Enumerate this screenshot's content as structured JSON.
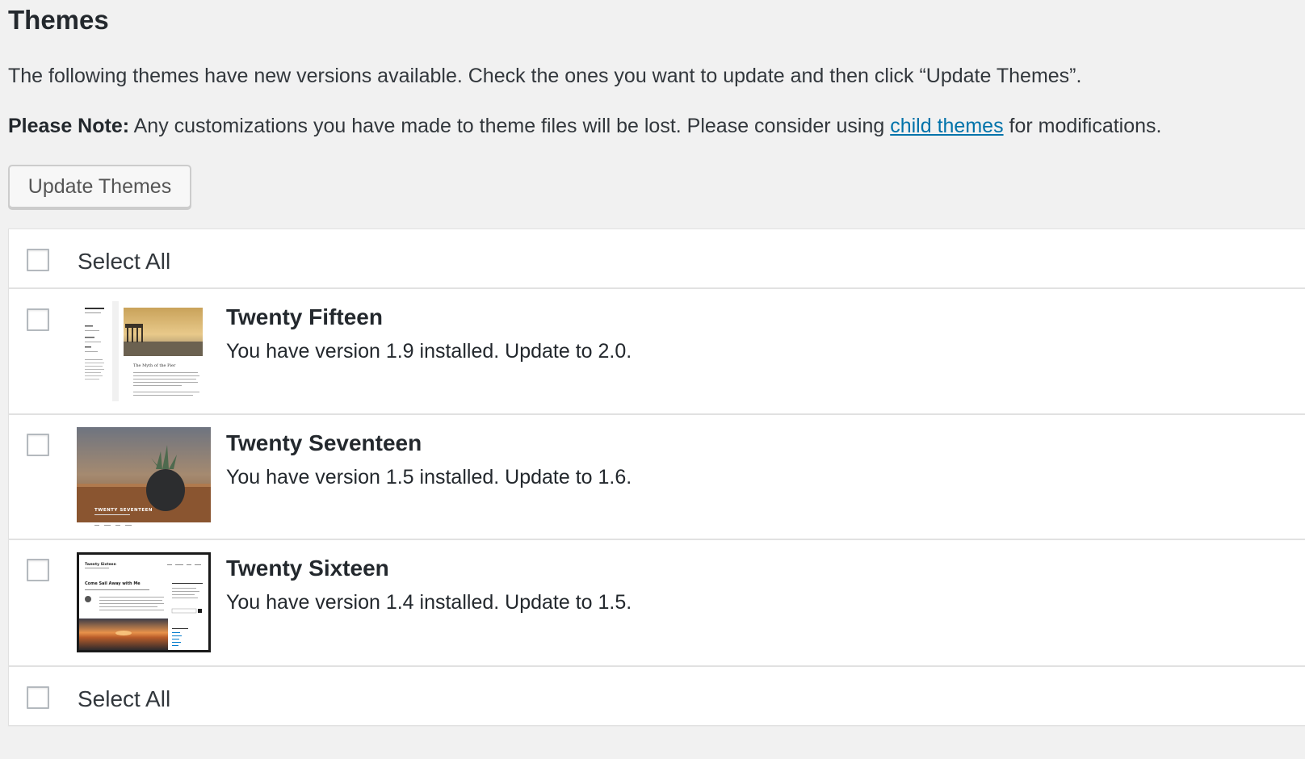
{
  "page": {
    "title": "Themes",
    "intro": "The following themes have new versions available. Check the ones you want to update and then click “Update Themes”.",
    "note_label": "Please Note:",
    "note_text_before": " Any customizations you have made to theme files will be lost. Please consider using ",
    "note_link": "child themes",
    "note_text_after": " for modifications.",
    "update_button": "Update Themes"
  },
  "table": {
    "select_all_top": "Select All",
    "select_all_bottom": "Select All",
    "themes": [
      {
        "name": "Twenty Fifteen",
        "description": "You have version 1.9 installed. Update to 2.0.",
        "screenshot_post_title": "The Myth of the Pier"
      },
      {
        "name": "Twenty Seventeen",
        "description": "You have version 1.5 installed. Update to 1.6.",
        "screenshot_banner": "TWENTY SEVENTEEN"
      },
      {
        "name": "Twenty Sixteen",
        "description": "You have version 1.4 installed. Update to 1.5.",
        "screenshot_site_title": "Twenty Sixteen",
        "screenshot_post_title": "Come Sail Away with Me"
      }
    ]
  },
  "colors": {
    "background": "#f1f1f1",
    "link": "#0073aa",
    "text": "#23282d",
    "border": "#e1e1e1"
  }
}
